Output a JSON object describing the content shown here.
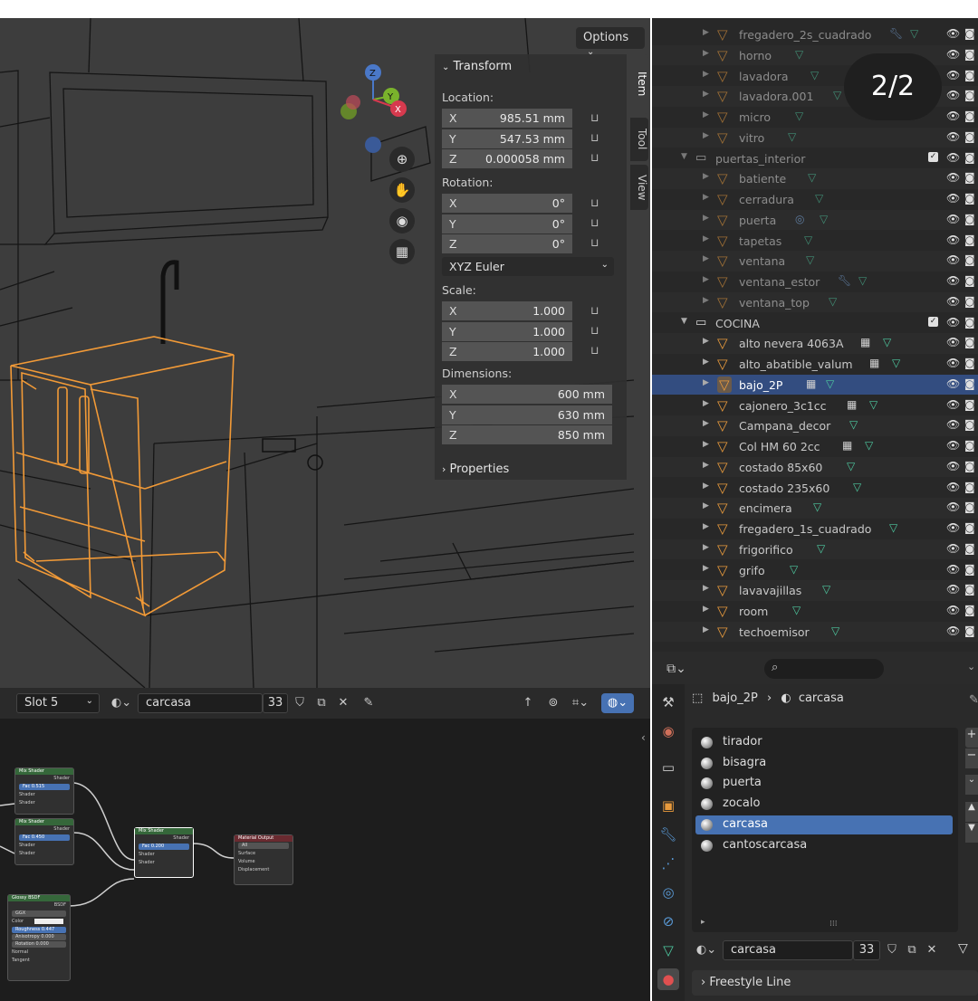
{
  "viewport": {
    "options_label": "Options",
    "gizmo": {
      "z": "Z",
      "y": "Y",
      "x": "X"
    },
    "npanel_tabs": [
      "Item",
      "Tool",
      "View"
    ],
    "transform": {
      "header": "Transform",
      "location_label": "Location:",
      "location": [
        {
          "axis": "X",
          "value": "985.51 mm"
        },
        {
          "axis": "Y",
          "value": "547.53 mm"
        },
        {
          "axis": "Z",
          "value": "0.000058 mm"
        }
      ],
      "rotation_label": "Rotation:",
      "rotation": [
        {
          "axis": "X",
          "value": "0°"
        },
        {
          "axis": "Y",
          "value": "0°"
        },
        {
          "axis": "Z",
          "value": "0°"
        }
      ],
      "rotation_mode": "XYZ Euler",
      "scale_label": "Scale:",
      "scale": [
        {
          "axis": "X",
          "value": "1.000"
        },
        {
          "axis": "Y",
          "value": "1.000"
        },
        {
          "axis": "Z",
          "value": "1.000"
        }
      ],
      "dimensions_label": "Dimensions:",
      "dimensions": [
        {
          "axis": "X",
          "value": "600 mm"
        },
        {
          "axis": "Y",
          "value": "630 mm"
        },
        {
          "axis": "Z",
          "value": "850 mm"
        }
      ]
    },
    "properties_header": "Properties"
  },
  "node_editor": {
    "slot": "Slot 5",
    "material": "carcasa",
    "users": "33",
    "nodes": {
      "mix1": {
        "title": "Mix Shader",
        "out": "Shader",
        "fac_label": "Fac",
        "fac": "0.515",
        "in1": "Shader",
        "in2": "Shader"
      },
      "mix2": {
        "title": "Mix Shader",
        "out": "Shader",
        "fac_label": "Fac",
        "fac": "0.450",
        "in1": "Shader",
        "in2": "Shader"
      },
      "mix3": {
        "title": "Mix Shader",
        "out": "Shader",
        "fac_label": "Fac",
        "fac": "0.200",
        "in1": "Shader",
        "in2": "Shader"
      },
      "output": {
        "title": "Material Output",
        "target": "All",
        "surface": "Surface",
        "volume": "Volume",
        "displacement": "Displacement"
      },
      "glossy": {
        "title": "Glossy BSDF",
        "out": "BSDF",
        "dist": "GGX",
        "color": "Color",
        "roughness": "Roughness 0.447",
        "anisotropy": "Anisotropy 0.000",
        "rotation": "Rotation 0.000",
        "normal": "Normal",
        "tangent": "Tangent"
      }
    }
  },
  "outliner": {
    "rows": [
      {
        "name": "fregadero_2s_cuadrado",
        "type": "mesh",
        "dim": true
      },
      {
        "name": "horno",
        "type": "mesh",
        "dim": true
      },
      {
        "name": "lavadora",
        "type": "mesh",
        "dim": true
      },
      {
        "name": "lavadora.001",
        "type": "mesh",
        "dim": true
      },
      {
        "name": "micro",
        "type": "mesh",
        "dim": true
      },
      {
        "name": "vitro",
        "type": "mesh",
        "dim": true
      },
      {
        "name": "puertas_interior",
        "type": "collection",
        "dim": true
      },
      {
        "name": "batiente",
        "type": "mesh",
        "dim": true
      },
      {
        "name": "cerradura",
        "type": "mesh",
        "dim": true
      },
      {
        "name": "puerta",
        "type": "mesh",
        "dim": true
      },
      {
        "name": "tapetas",
        "type": "mesh",
        "dim": true
      },
      {
        "name": "ventana",
        "type": "mesh",
        "dim": true
      },
      {
        "name": "ventana_estor",
        "type": "mesh",
        "dim": true
      },
      {
        "name": "ventana_top",
        "type": "mesh",
        "dim": true
      },
      {
        "name": "COCINA",
        "type": "collection",
        "dim": false
      },
      {
        "name": "alto nevera 4063A",
        "type": "mesh",
        "dim": false
      },
      {
        "name": "alto_abatible_valum",
        "type": "mesh",
        "dim": false
      },
      {
        "name": "bajo_2P",
        "type": "mesh",
        "dim": false,
        "selected": true
      },
      {
        "name": "cajonero_3c1cc",
        "type": "mesh",
        "dim": false
      },
      {
        "name": "Campana_decor",
        "type": "mesh",
        "dim": false
      },
      {
        "name": "Col HM 60 2cc",
        "type": "mesh",
        "dim": false
      },
      {
        "name": "costado 85x60",
        "type": "mesh",
        "dim": false
      },
      {
        "name": "costado 235x60",
        "type": "mesh",
        "dim": false
      },
      {
        "name": "encimera",
        "type": "mesh",
        "dim": false
      },
      {
        "name": "fregadero_1s_cuadrado",
        "type": "mesh",
        "dim": false
      },
      {
        "name": "frigorifico",
        "type": "mesh",
        "dim": false
      },
      {
        "name": "grifo",
        "type": "mesh",
        "dim": false
      },
      {
        "name": "lavavajillas",
        "type": "mesh",
        "dim": false
      },
      {
        "name": "room",
        "type": "mesh",
        "dim": false
      },
      {
        "name": "techoemisor",
        "type": "mesh",
        "dim": false
      }
    ]
  },
  "page_badge": "2/2",
  "properties": {
    "breadcrumb_object": "bajo_2P",
    "breadcrumb_material": "carcasa",
    "slots": [
      "tirador",
      "bisagra",
      "puerta",
      "zocalo",
      "carcasa",
      "cantoscarcasa"
    ],
    "selected_slot": "carcasa",
    "material": "carcasa",
    "users": "33",
    "freestyle_label": "Freestyle Line"
  },
  "colors": {
    "selection_outline": "#f29a37",
    "selected_row": "#334d80",
    "active_blue": "#4772b3",
    "mesh_icon": "#e89a3c",
    "data_icon": "#4ec9a0"
  }
}
